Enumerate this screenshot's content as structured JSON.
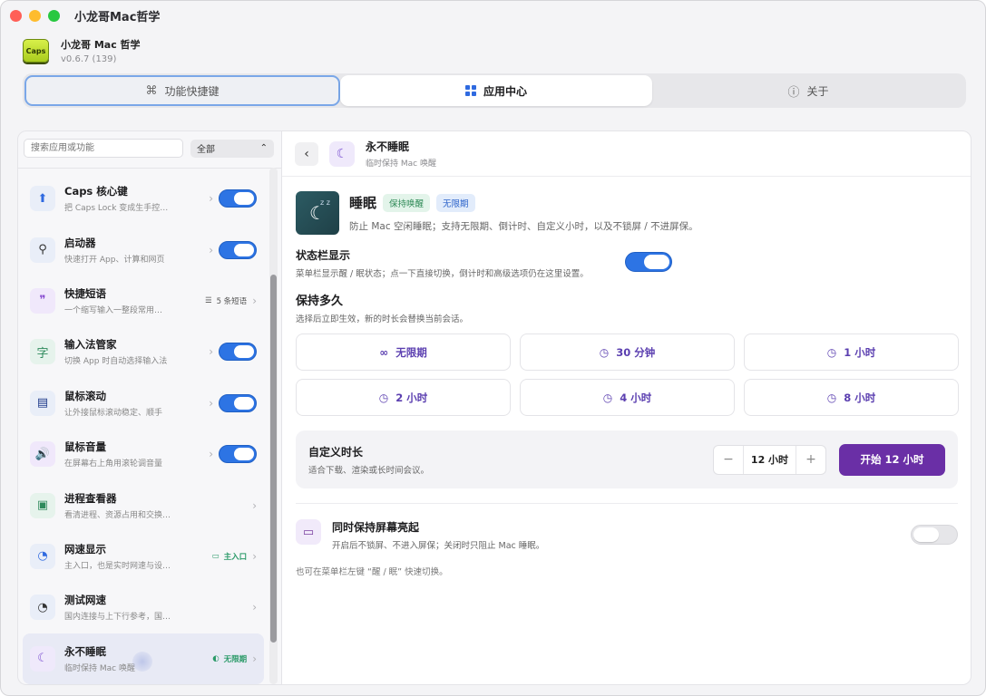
{
  "window": {
    "title": "小龙哥Mac哲学"
  },
  "app": {
    "logo_text": "Caps",
    "name": "小龙哥 Mac 哲学",
    "version": "v0.6.7 (139)"
  },
  "tabs": [
    {
      "icon": "⌘",
      "label": "功能快捷键"
    },
    {
      "icon": "grid",
      "label": "应用中心"
    },
    {
      "icon": "ⓘ",
      "label": "关于"
    }
  ],
  "sidebar": {
    "search_placeholder": "搜索应用或功能",
    "filter": "全部",
    "items": [
      {
        "icon": "⬆",
        "title": "Caps 核心键",
        "sub": "把 Caps Lock 变成生手控…",
        "toggle": true,
        "badge": ""
      },
      {
        "icon": "🔍",
        "title": "启动器",
        "sub": "快速打开 App、计算和网页",
        "toggle": true,
        "badge": ""
      },
      {
        "icon": "❞",
        "title": "快捷短语",
        "sub": "一个缩写输入一整段常用…",
        "toggle": null,
        "badge": "5 条短语"
      },
      {
        "icon": "字",
        "title": "输入法管家",
        "sub": "切换 App 时自动选择输入法",
        "toggle": true,
        "badge": ""
      },
      {
        "icon": "▤",
        "title": "鼠标滚动",
        "sub": "让外接鼠标滚动稳定、顺手",
        "toggle": true,
        "badge": ""
      },
      {
        "icon": "🔊",
        "title": "鼠标音量",
        "sub": "在屏幕右上角用滚轮调音量",
        "toggle": true,
        "badge": ""
      },
      {
        "icon": "▣",
        "title": "进程查看器",
        "sub": "看清进程、资源占用和交换空间",
        "toggle": null,
        "badge": ""
      },
      {
        "icon": "◔",
        "title": "网速显示",
        "sub": "主入口，也是实时网速与设…",
        "toggle": null,
        "badge": "主入口"
      },
      {
        "icon": "◔",
        "title": "测试网速",
        "sub": "国内连接与上下行参考，国外连接",
        "toggle": null,
        "badge": ""
      },
      {
        "icon": "☾",
        "title": "永不睡眠",
        "sub": "临时保持 Mac 唤醒",
        "toggle": null,
        "badge": "无限期"
      }
    ]
  },
  "main": {
    "header": {
      "title": "永不睡眠",
      "subtitle": "临时保持 Mac 唤醒"
    },
    "hero": {
      "title": "睡眠",
      "pill_awake": "保持唤醒",
      "pill_unlimited": "无限期",
      "desc": "防止 Mac 空闲睡眠；支持无限期、倒计时、自定义小时，以及不锁屏 / 不进屏保。"
    },
    "status_bar": {
      "title": "状态栏显示",
      "sub": "菜单栏显示醒 / 眠状态；点一下直接切换，倒计时和高级选项仍在这里设置。",
      "on": true
    },
    "duration": {
      "title": "保持多久",
      "sub": "选择后立即生效，新的时长会替换当前会话。",
      "options": [
        "无限期",
        "30 分钟",
        "1 小时",
        "2 小时",
        "4 小时",
        "8 小时"
      ]
    },
    "custom": {
      "title": "自定义时长",
      "sub": "适合下载、渲染或长时间会议。",
      "minus": "−",
      "value": "12 小时",
      "plus": "+",
      "start_label": "开始 12 小时"
    },
    "screen": {
      "title": "同时保持屏幕亮起",
      "sub": "开启后不锁屏、不进入屏保；关闭时只阻止 Mac 睡眠。",
      "on": false
    },
    "footnote": "也可在菜单栏左键 “醒 / 眠” 快速切换。"
  },
  "colors": {
    "accent_blue": "#2d74e4",
    "accent_purple": "#6a2fa6",
    "green_badge": "#2a9a68"
  }
}
